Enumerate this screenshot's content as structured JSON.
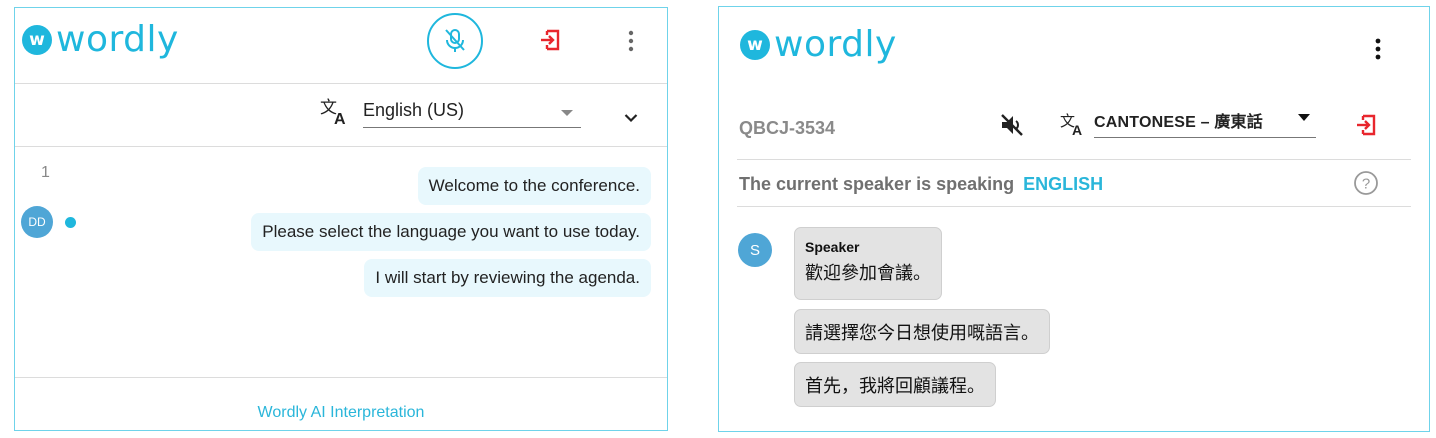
{
  "left": {
    "logo_letter": "w",
    "logo_text": "wordly",
    "language_selected": "English (US)",
    "message_number": "1",
    "avatar_initials": "DD",
    "messages": [
      "Welcome to the conference.",
      "Please select the language you want to use today.",
      "I will start by reviewing the agenda."
    ],
    "footer_link": "Wordly AI Interpretation"
  },
  "right": {
    "logo_letter": "w",
    "logo_text": "wordly",
    "session_code": "QBCJ-3534",
    "language_selected": "CANTONESE – 廣東話",
    "speaker_status_text": "The current speaker is speaking",
    "speaker_language": "ENGLISH",
    "avatar_initial": "S",
    "speaker_name": "Speaker",
    "messages": [
      "歡迎參加會議。",
      "請選擇您今日想使用嘅語言。",
      "首先，我將回顧議程。"
    ]
  },
  "colors": {
    "accent": "#1fb7dd",
    "exit_red": "#e8262d",
    "bubble_blue": "#e8f8fd",
    "bubble_grey": "#e3e3e3"
  },
  "icons": [
    "mic-off-icon",
    "exit-icon",
    "more-vert-icon",
    "translate-icon",
    "chevron-down-icon",
    "speaker-muted-icon",
    "help-icon",
    "dropdown-caret-icon"
  ]
}
